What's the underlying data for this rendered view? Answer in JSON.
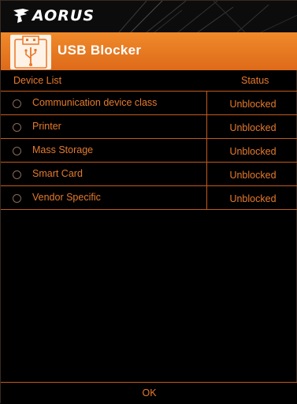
{
  "brand": {
    "logo_text": "AORUS",
    "logo_icon": "aorus-eagle-icon"
  },
  "header": {
    "title": "USB Blocker",
    "icon": "usb-icon"
  },
  "columns": {
    "device": "Device List",
    "status": "Status"
  },
  "devices": [
    {
      "label": "Communication device class",
      "status": "Unblocked",
      "selected": false
    },
    {
      "label": "Printer",
      "status": "Unblocked",
      "selected": false
    },
    {
      "label": "Mass Storage",
      "status": "Unblocked",
      "selected": false
    },
    {
      "label": "Smart Card",
      "status": "Unblocked",
      "selected": false
    },
    {
      "label": "Vendor Specific",
      "status": "Unblocked",
      "selected": false
    }
  ],
  "footer": {
    "ok_label": "OK"
  },
  "colors": {
    "accent": "#e8782a",
    "background": "#000000",
    "header": "#e9761f"
  }
}
